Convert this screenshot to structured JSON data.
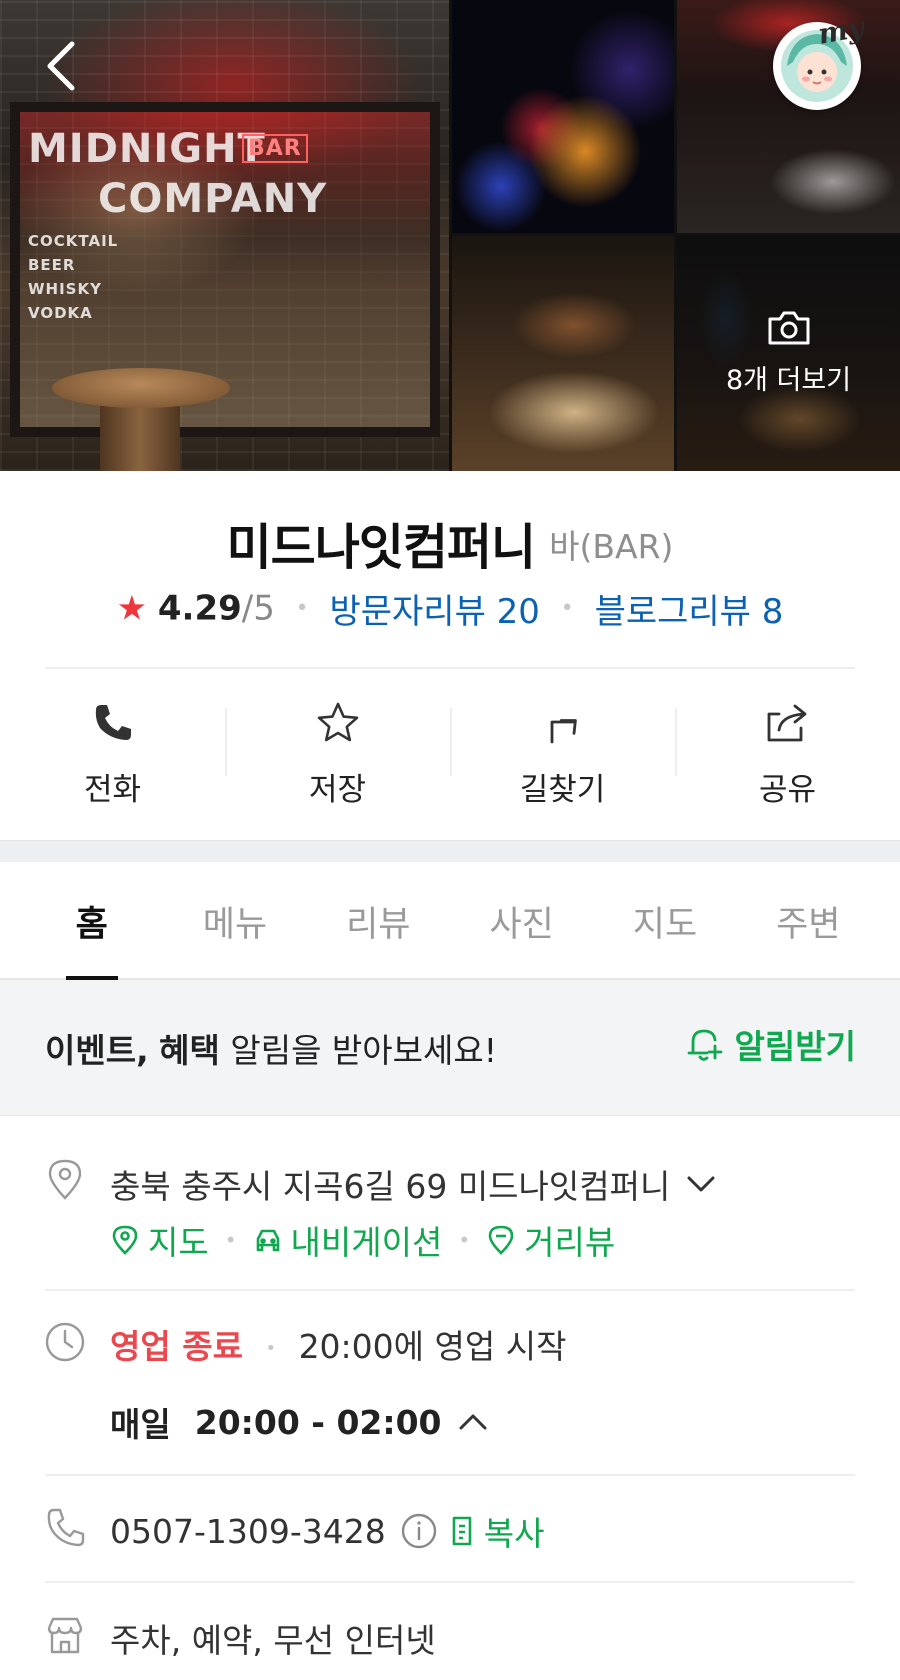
{
  "gallery": {
    "more_label": "8개 더보기",
    "my_label": "my",
    "sign_lines": [
      "MIDNIGHT",
      "COMPANY",
      "BAR"
    ],
    "menu_lines": [
      "COCKTAIL",
      "BEER",
      "WHISKY",
      "VODKA"
    ]
  },
  "place": {
    "name": "미드나잇컴퍼니",
    "category": "바(BAR)",
    "rating": "4.29",
    "rating_max": "/5",
    "visitor_reviews": "방문자리뷰 20",
    "blog_reviews": "블로그리뷰 8"
  },
  "actions": [
    {
      "label": "전화",
      "icon": "phone-icon"
    },
    {
      "label": "저장",
      "icon": "star-outline-icon"
    },
    {
      "label": "길찾기",
      "icon": "directions-icon"
    },
    {
      "label": "공유",
      "icon": "share-icon"
    }
  ],
  "tabs": [
    {
      "label": "홈",
      "active": true
    },
    {
      "label": "메뉴",
      "active": false
    },
    {
      "label": "리뷰",
      "active": false
    },
    {
      "label": "사진",
      "active": false
    },
    {
      "label": "지도",
      "active": false
    },
    {
      "label": "주변",
      "active": false
    }
  ],
  "notice": {
    "bold1": "이벤트,",
    "bold2": "혜택",
    "text": " 알림을 받아보세요!",
    "button": "알림받기"
  },
  "address": {
    "text": "충북 충주시 지곡6길 69 미드나잇컴퍼니",
    "links": [
      "지도",
      "내비게이션",
      "거리뷰"
    ]
  },
  "hours": {
    "status": "영업 종료",
    "next_open": "20:00에 영업 시작",
    "day": "매일",
    "time": "20:00 - 02:00"
  },
  "phone": {
    "number": "0507-1309-3428",
    "copy_label": "복사"
  },
  "amenities": {
    "text": "주차, 예약, 무선 인터넷"
  },
  "colors": {
    "accent_green": "#0fa84e",
    "link_blue": "#0b61b3",
    "closed_red": "#e8484e",
    "star_red": "#f0363d"
  }
}
